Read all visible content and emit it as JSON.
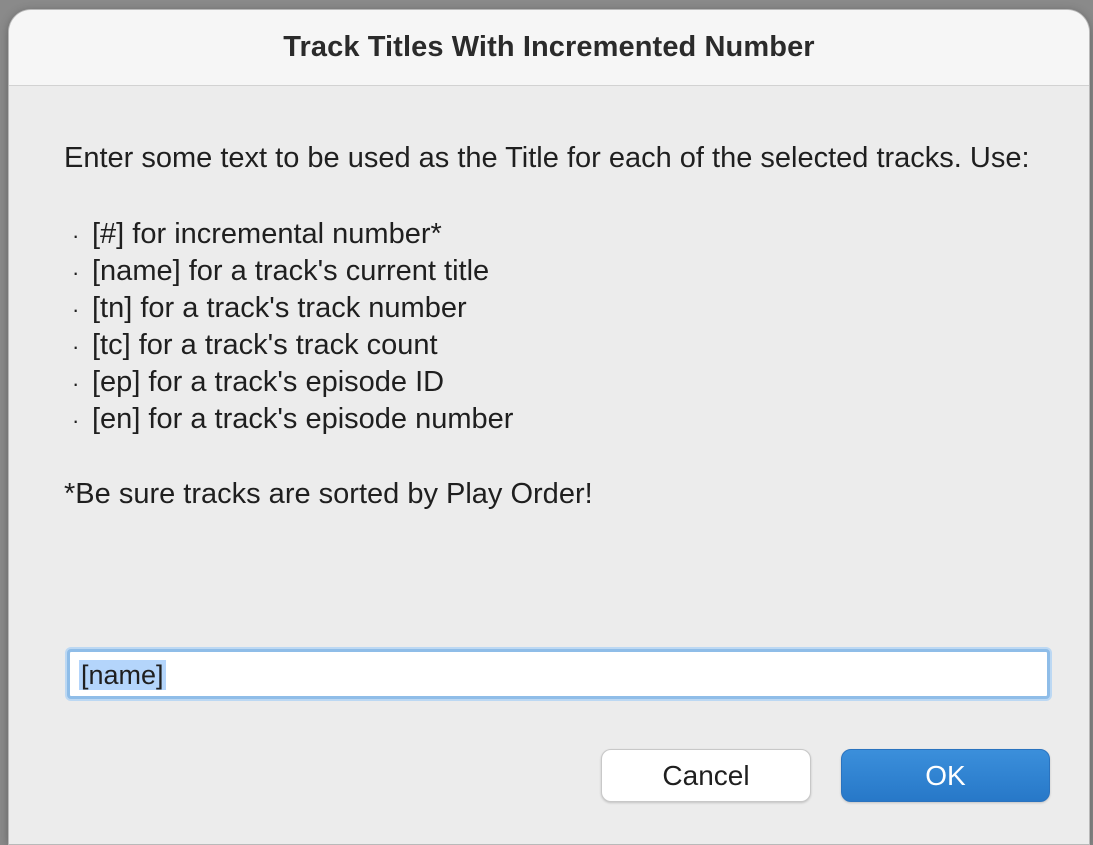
{
  "dialog": {
    "title": "Track Titles With Incremented Number",
    "intro": "Enter some text to be used as the Title for each of the selected tracks. Use:",
    "bullet_glyph": "·",
    "items": [
      {
        "label": "[#] for incremental number*"
      },
      {
        "label": "[name] for a track's current title"
      },
      {
        "label": "[tn] for a track's track number"
      },
      {
        "label": "[tc] for a track's track count"
      },
      {
        "label": "[ep] for a track's episode ID"
      },
      {
        "label": "[en] for a track's episode number"
      }
    ],
    "note": "*Be sure tracks are sorted by Play Order!",
    "input_value": "[name]",
    "cancel_label": "Cancel",
    "ok_label": "OK"
  },
  "colors": {
    "accent": "#2f82d2",
    "selection": "#b4d5fb",
    "dialog_bg": "#ececec"
  }
}
